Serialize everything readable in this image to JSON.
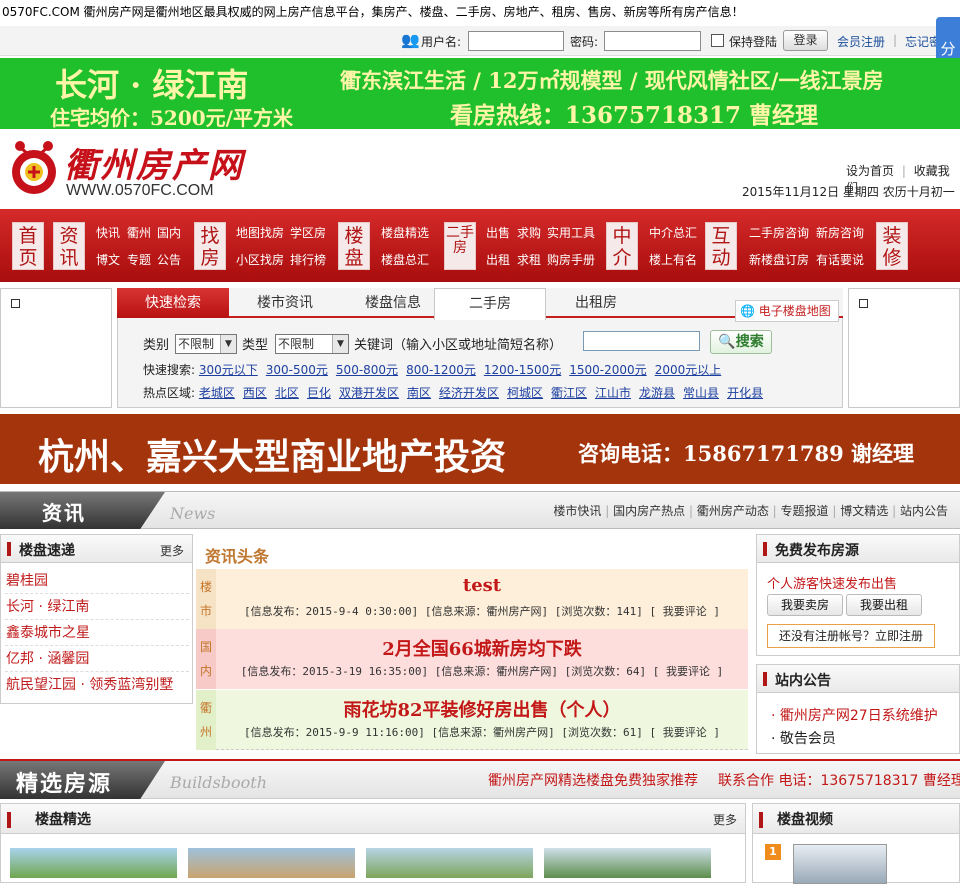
{
  "site": {
    "intro": "0570FC.COM 衢州房产网是衢州地区最具权威的网上房产信息平台，集房产、楼盘、二手房、房地产、租房、售房、新房等所有房产信息！",
    "logo_title": "衢州房产网",
    "logo_url": "WWW.0570FC.COM"
  },
  "login": {
    "username_label": "用户名:",
    "password_label": "密码:",
    "remember_label": "保持登陆",
    "login_button": "登录",
    "register_link": "会员注册",
    "forgot_link": "忘记密"
  },
  "share_label": "分享",
  "green_banner": {
    "project": "长河 · 绿江南",
    "price": "住宅均价：5200元/平方米",
    "tagline": "衢东滨江生活 / 12万㎡规模型 / 现代风情社区/一线江景房",
    "hotline": "看房热线：13675718317 曹经理"
  },
  "header": {
    "set_home": "设为首页",
    "bookmark": "收藏我们",
    "date": "2015年11月12日 星期四 农历十月初一"
  },
  "nav": {
    "home": "首页",
    "news": "资讯",
    "news_links": [
      "快讯",
      "衢州",
      "国内",
      "博文",
      "专题",
      "公告"
    ],
    "find": "找房",
    "find_links": [
      "地图找房",
      "学区房",
      "小区找房",
      "排行榜"
    ],
    "estate": "楼盘",
    "estate_links": [
      "楼盘精选",
      "楼盘总汇"
    ],
    "second": "二手房",
    "second_links": [
      "出售",
      "求购",
      "实用工具",
      "出租",
      "求租",
      "购房手册"
    ],
    "agent": "中介",
    "agent_links": [
      "中介总汇",
      "楼上有名"
    ],
    "interact": "互动",
    "interact_links": [
      "二手房咨询",
      "新房咨询",
      "新楼盘订房",
      "有话要说"
    ],
    "decor": "装修"
  },
  "search": {
    "tabs": [
      "快速检索",
      "楼市资讯",
      "楼盘信息",
      "二手房",
      "出租房"
    ],
    "map_button": "电子楼盘地图",
    "category_label": "类别",
    "category_value": "不限制",
    "type_label": "类型",
    "type_value": "不限制",
    "keyword_label": "关键词（输入小区或地址简短名称）",
    "search_button": "搜索",
    "quick_label": "快速搜索:",
    "quick_links": [
      "300元以下",
      "300-500元",
      "500-800元",
      "800-1200元",
      "1200-1500元",
      "1500-2000元",
      "2000元以上"
    ],
    "area_label": "热点区域:",
    "area_links": [
      "老城区",
      "西区",
      "北区",
      "巨化",
      "双港开发区",
      "南区",
      "经济开发区",
      "柯城区",
      "衢江区",
      "江山市",
      "龙游县",
      "常山县",
      "开化县"
    ]
  },
  "brown_banner": {
    "headline": "杭州、嘉兴大型商业地产投资",
    "contact": "咨询电话：15867171789 谢经理"
  },
  "news_section": {
    "label": "资讯",
    "en_label": "News",
    "links": [
      "楼市快讯",
      "国内房产热点",
      "衢州房产动态",
      "专题报道",
      "博文精选",
      "站内公告"
    ]
  },
  "express": {
    "title": "楼盘速递",
    "more": "更多",
    "items": [
      "碧桂园",
      "长河 · 绿江南",
      "鑫泰城市之星",
      "亿邦 · 涵馨园",
      "航民望江园 · 领秀蓝湾别墅"
    ]
  },
  "headlines": {
    "title": "资讯头条",
    "items": [
      {
        "tag": "楼市",
        "title": "test",
        "meta": "[信息发布：2015-9-4 0:30:00] [信息来源：衢州房产网] [浏览次数：141] [ 我要评论 ]",
        "bg": "#fdefd9"
      },
      {
        "tag": "国内",
        "title": "2月全国66城新房均下跌",
        "meta": "[信息发布：2015-3-19 16:35:00] [信息来源：衢州房产网] [浏览次数：64] [ 我要评论 ]",
        "bg": "#fddedd"
      },
      {
        "tag": "衢州",
        "title": "雨花坊82平装修好房出售（个人）",
        "meta": "[信息发布：2015-9-9 11:16:00] [信息来源：衢州房产网] [浏览次数：61] [ 我要评论 ]",
        "bg": "#eff8df"
      }
    ]
  },
  "free_post": {
    "title": "免费发布房源",
    "subtitle": "个人游客快速发布出售",
    "sell_button": "我要卖房",
    "rent_button": "我要出租",
    "registered": "还没有注册帐号？立即注册"
  },
  "notice": {
    "title": "站内公告",
    "items": [
      "· 衢州房产网27日系统维护",
      "· 敬告会员"
    ]
  },
  "builds": {
    "label": "精选房源",
    "en_label": "Buildsbooth",
    "promo": "衢州房产网精选楼盘免费独家推荐",
    "contact": "联系合作 电话：13675718317 曹经理",
    "panel_title": "楼盘精选",
    "panel_more": "更多",
    "video_title": "楼盘视频",
    "video_rank": "1"
  }
}
